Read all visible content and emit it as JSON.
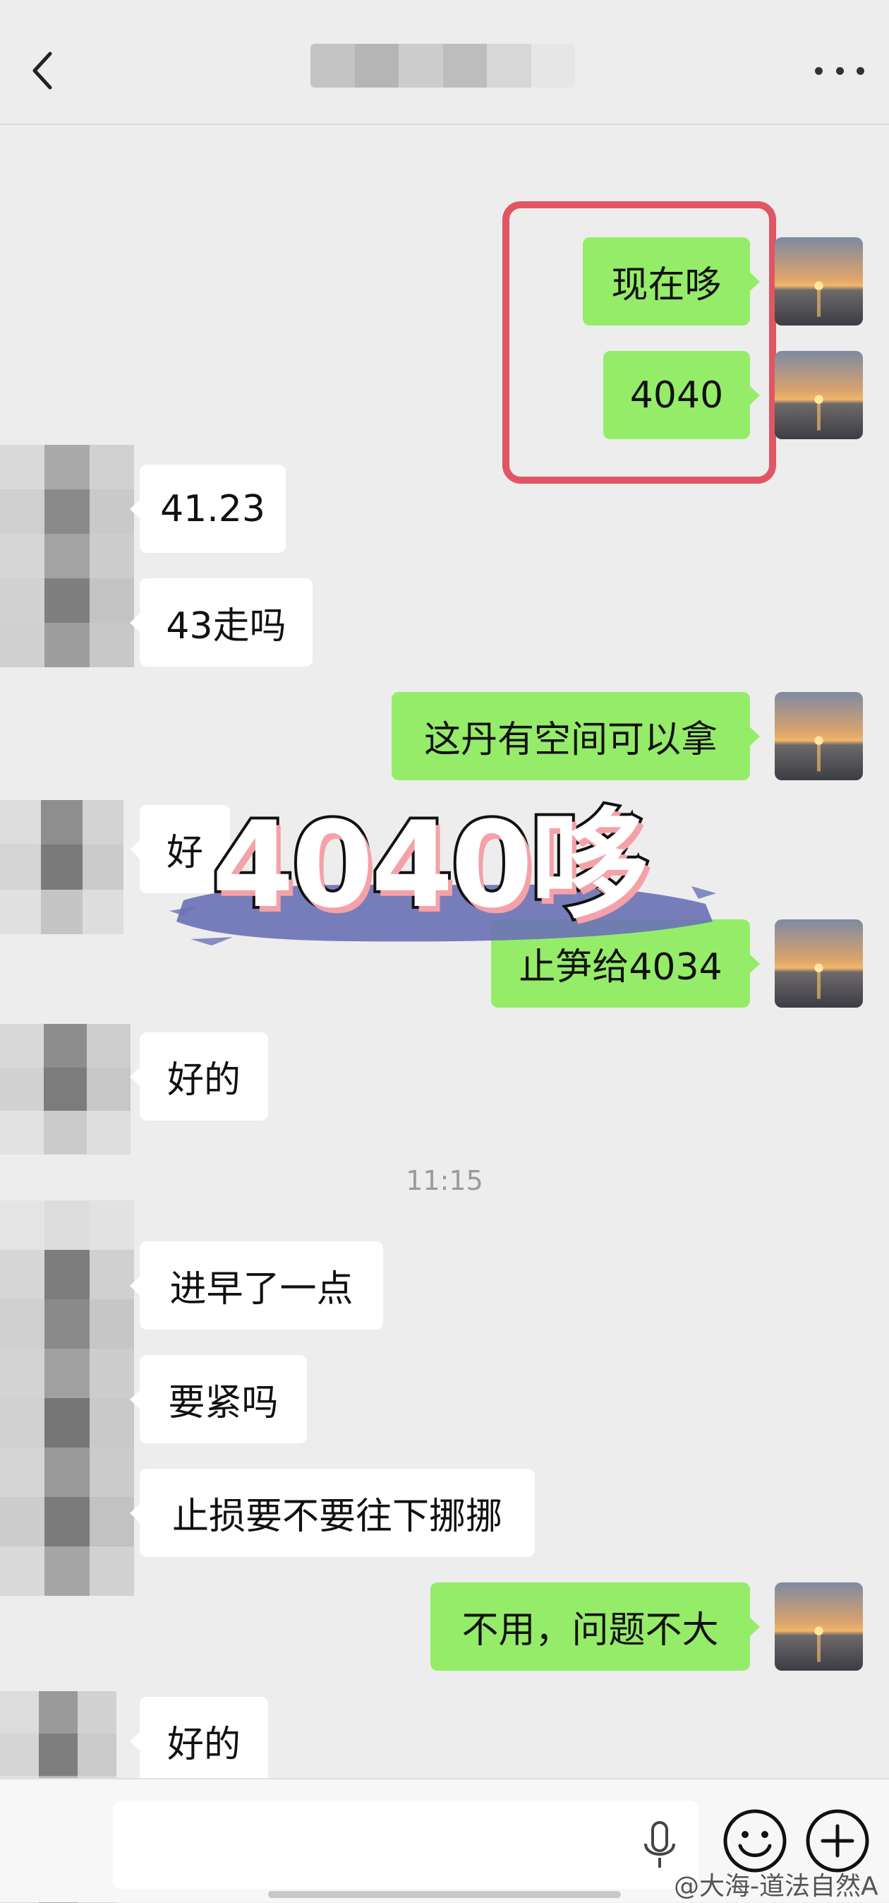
{
  "header": {
    "title_blurred": true,
    "back_icon": "chevron-left-icon",
    "more_icon": "more-dots-icon"
  },
  "messages": [
    {
      "side": "me",
      "text": "现在哆"
    },
    {
      "side": "me",
      "text": "4040"
    },
    {
      "side": "them",
      "text": "41.23"
    },
    {
      "side": "them",
      "text": "43走吗"
    },
    {
      "side": "me",
      "text": "这丹有空间可以拿"
    },
    {
      "side": "them",
      "text": "好"
    },
    {
      "side": "me",
      "text": "止笋给4034"
    },
    {
      "side": "them",
      "text": "好的"
    },
    {
      "side": "them",
      "text": "进早了一点"
    },
    {
      "side": "them",
      "text": "要紧吗"
    },
    {
      "side": "them",
      "text": "止损要不要往下挪挪"
    },
    {
      "side": "me",
      "text": "不用，问题不大"
    },
    {
      "side": "them",
      "text": "好的"
    }
  ],
  "timestamp": "11:15",
  "overlay": {
    "text": "4040哆"
  },
  "input": {
    "value": ""
  },
  "watermark": "@大海-道法自然A",
  "colors": {
    "bg": "#ededed",
    "my_bubble": "#95ec69",
    "their_bubble": "#ffffff",
    "highlight": "#e05664",
    "brush": "#6b73b5"
  }
}
